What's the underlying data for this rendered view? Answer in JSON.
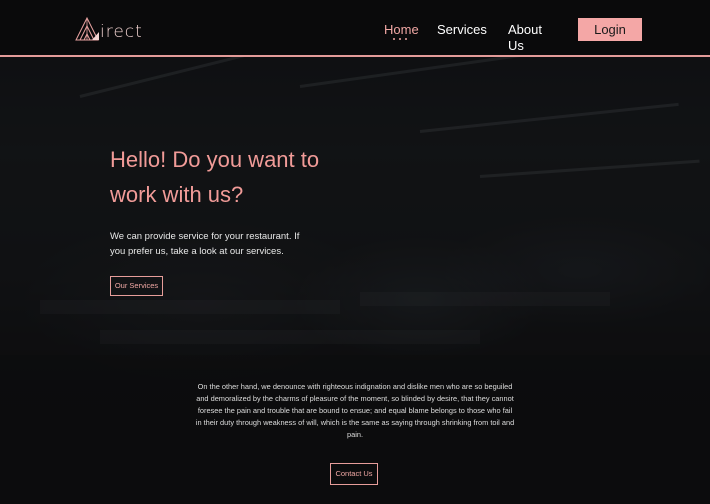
{
  "header": {
    "logo_text": "irect",
    "nav": [
      {
        "label": "Home",
        "active": true
      },
      {
        "label": "Services",
        "active": false
      },
      {
        "label": "About Us",
        "active": false
      }
    ],
    "login_label": "Login"
  },
  "hero": {
    "title": "Hello! Do you want to work with us?",
    "description": "We can provide service for your restaurant. If you prefer us, take a look at our services.",
    "services_button": "Our Services"
  },
  "about": {
    "paragraph": "On the other hand, we denounce with righteous indignation and dislike men who are so beguiled and demoralized by the charms of pleasure of the moment, so blinded by desire, that they cannot foresee the pain and trouble that are bound to ensue; and equal blame belongs to those who fail in their duty through weakness of will, which is the same as saying through shrinking from toil and pain.",
    "contact_button": "Contact Us"
  },
  "colors": {
    "accent": "#f0a7a4",
    "login_bg": "#f4a7a6",
    "header_bg": "#0a0a0b",
    "page_bg": "#0b0b0c"
  },
  "icons": {
    "logo": "logo-mark-icon"
  }
}
